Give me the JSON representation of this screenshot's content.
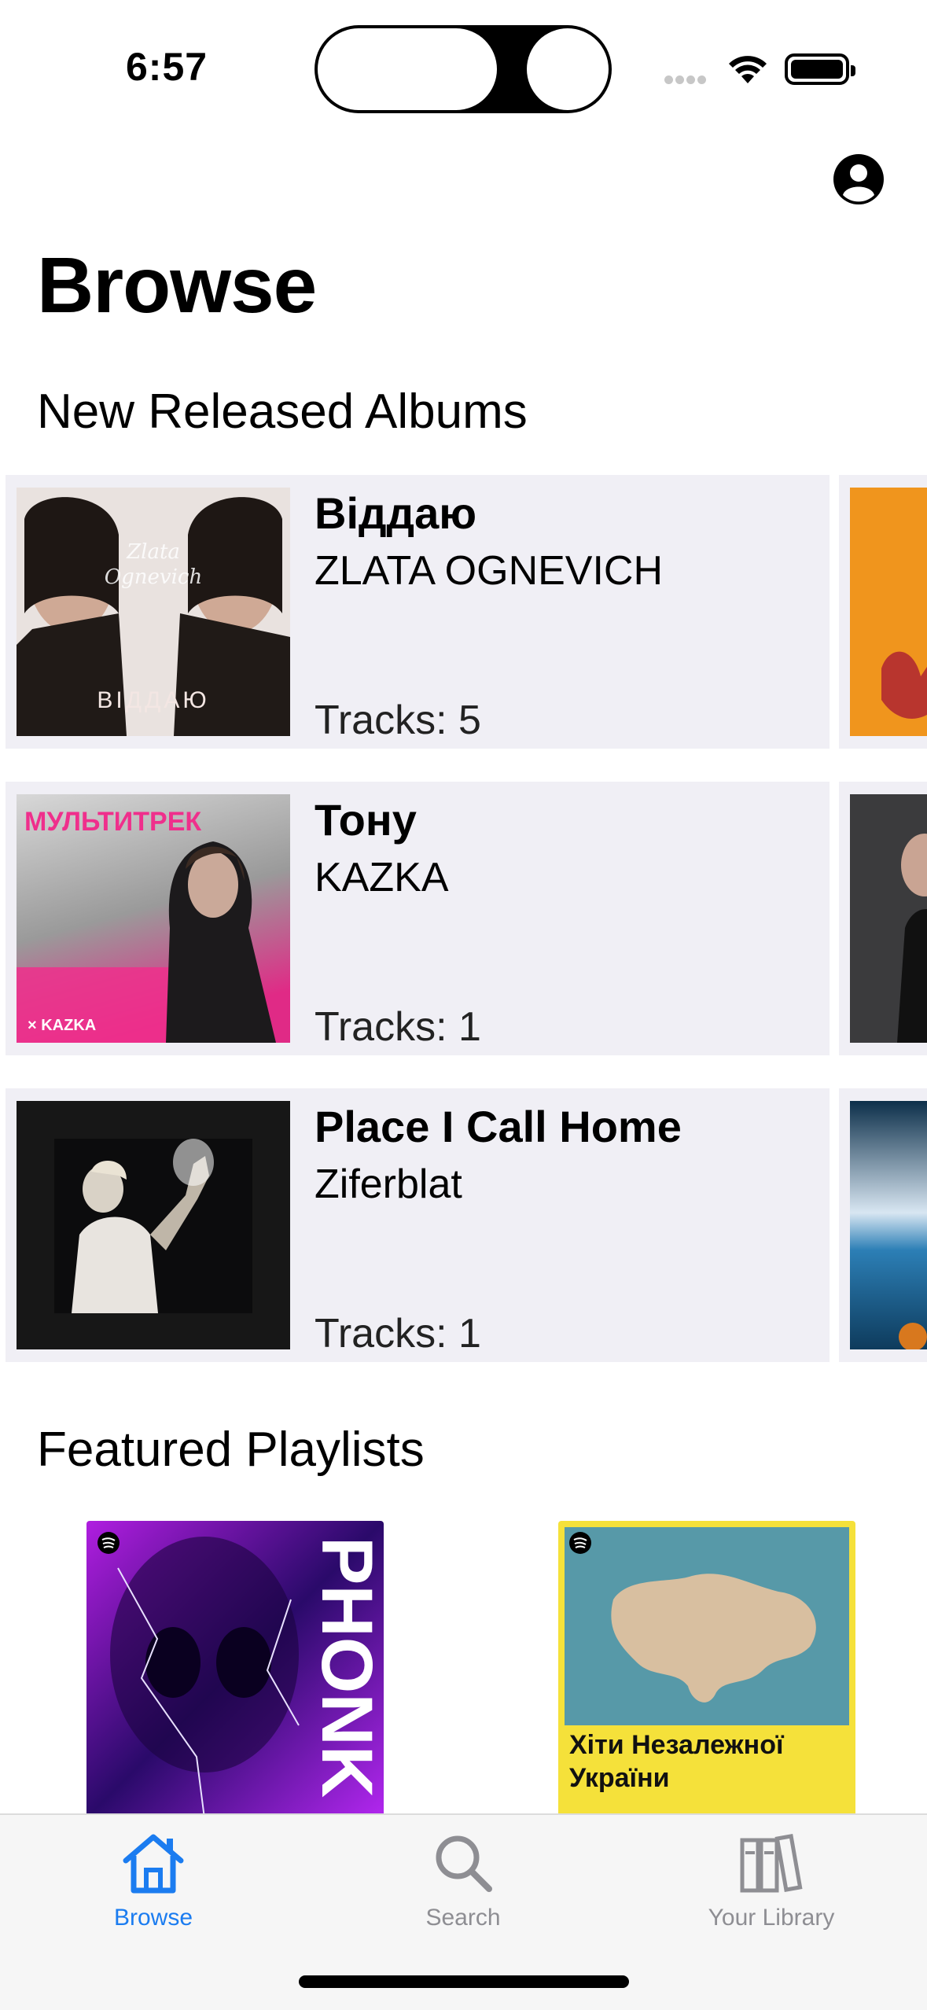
{
  "status_bar": {
    "time": "6:57"
  },
  "page": {
    "title": "Browse"
  },
  "sections": {
    "albums_title": "New Released Albums",
    "playlists_title": "Featured Playlists"
  },
  "albums": [
    {
      "name": "Віддаю",
      "artist": "ZLATA OGNEVICH",
      "tracks": "Tracks: 5",
      "cover_text": "ВІДДАЮ"
    },
    {
      "name": "Тону",
      "artist": "KAZKA",
      "tracks": "Tracks: 1",
      "cover_text": "МУЛЬТИТРЕК",
      "cover_sub": "× KAZKA"
    },
    {
      "name": "Place I Call Home",
      "artist": "Ziferblat",
      "tracks": "Tracks: 1"
    }
  ],
  "playlists": [
    {
      "cover_text": "PHONK",
      "accent": "#7b1fd6"
    },
    {
      "cover_text": "Хіти Незалежної України",
      "accent": "#f5e13a"
    }
  ],
  "tab_bar": {
    "tabs": [
      {
        "label": "Browse",
        "icon": "house-icon",
        "active": true
      },
      {
        "label": "Search",
        "icon": "magnifier-icon",
        "active": false
      },
      {
        "label": "Your Library",
        "icon": "library-icon",
        "active": false
      }
    ],
    "active_color": "#1b7cf0",
    "inactive_color": "#8e8e93"
  }
}
